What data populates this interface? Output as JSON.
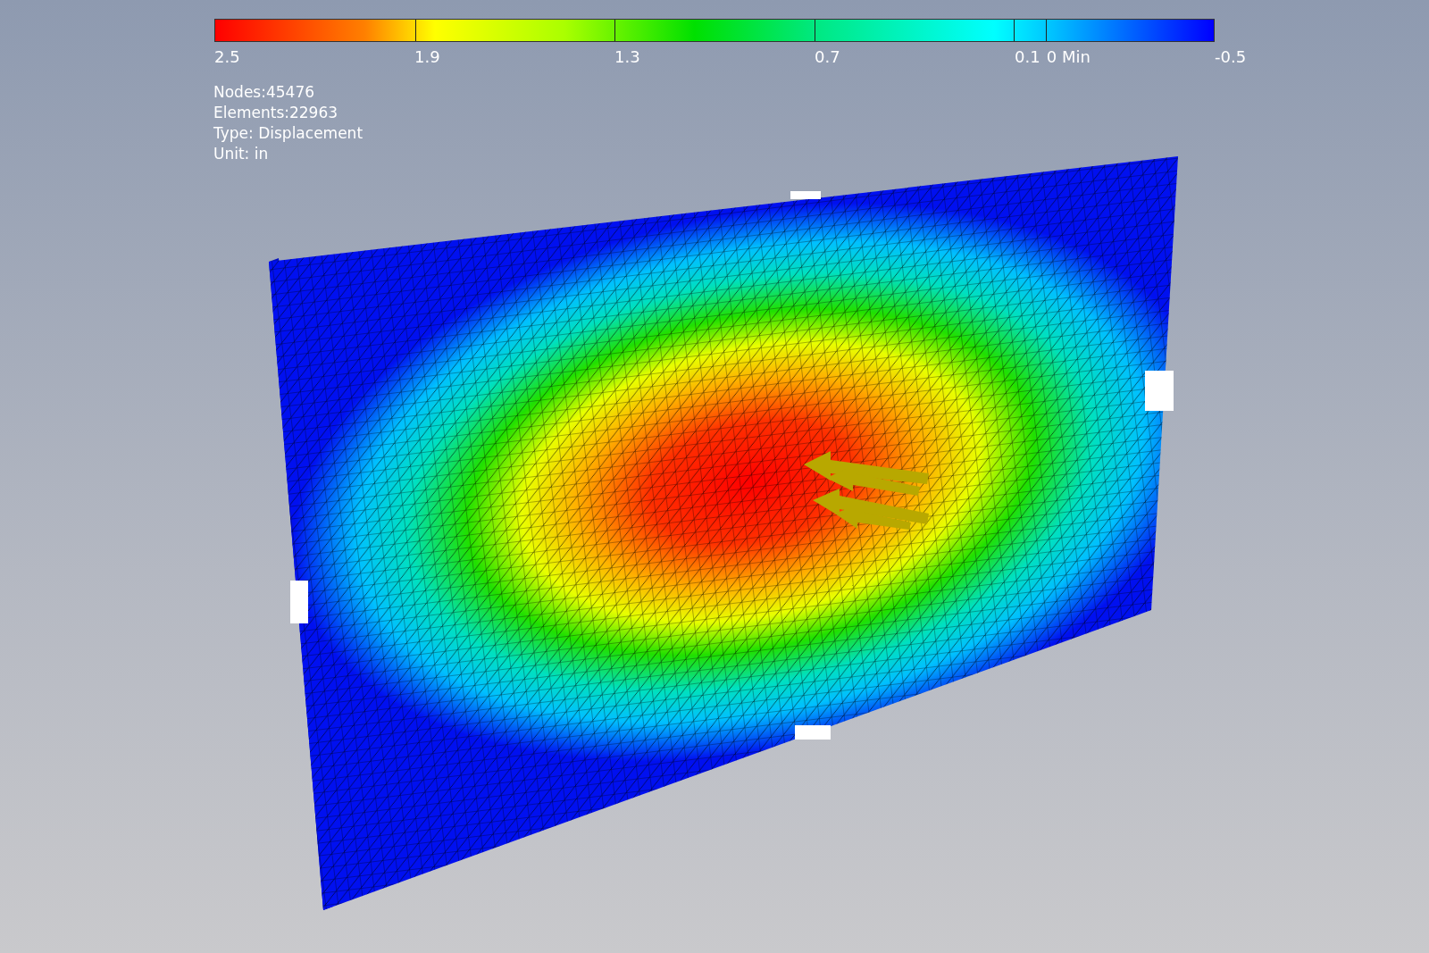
{
  "legend": {
    "labels": [
      "2.5",
      "1.9",
      "1.3",
      "0.7",
      "0.1",
      "0 Min",
      "-0.5"
    ]
  },
  "info": [
    "Nodes:45476",
    "Elements:22963",
    "Type: Displacement",
    "Unit: in"
  ]
}
